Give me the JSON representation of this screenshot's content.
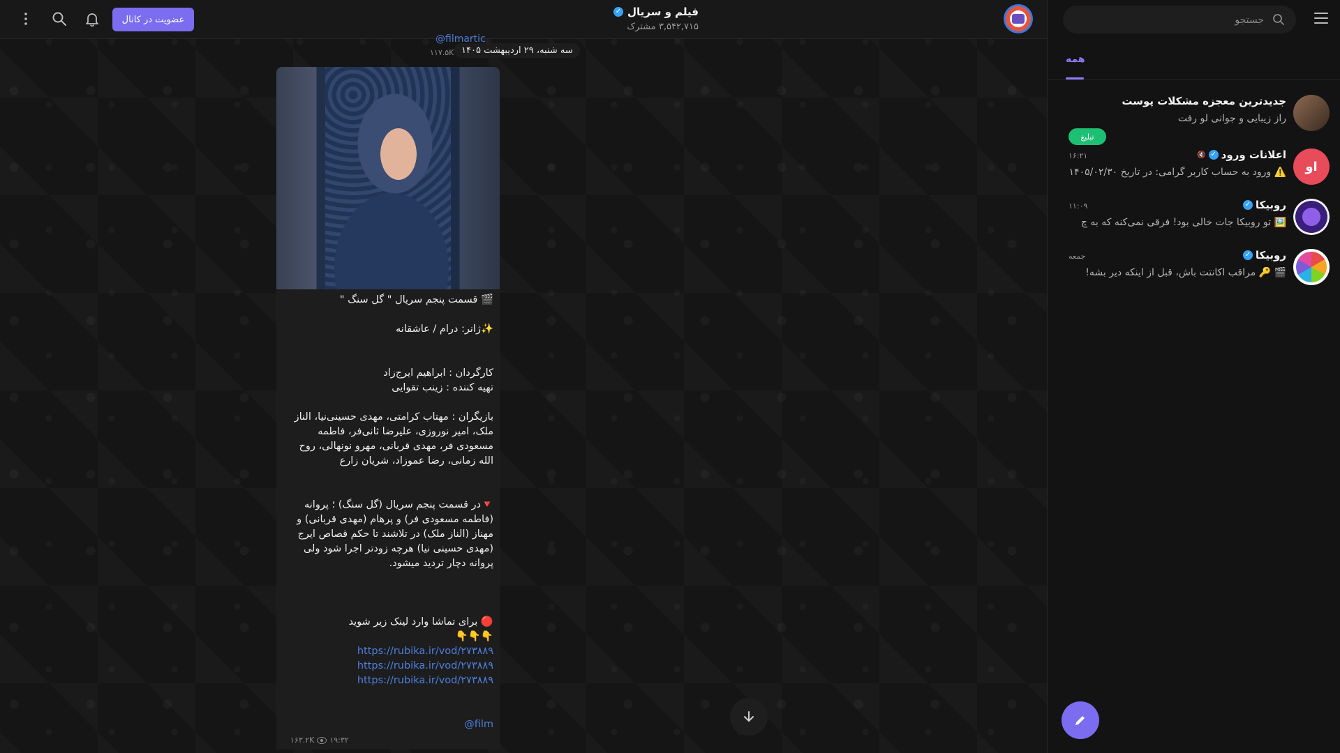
{
  "header": {
    "channel_name": "فیلم و سریال",
    "subscribers": "۳,۵۴۲,۷۱۵ مشترک",
    "join_button": "عضویت در کانال"
  },
  "date_separator": "سه شنبه، ۲۹ اردیبهشت ۱۴۰۵",
  "previous_message": {
    "handle": "@filmartic",
    "views": "۱۱۷.۵K"
  },
  "message": {
    "title": "🎬 قسمت پنجم سریال \" گل سنگ \"",
    "genre": "✨ژانر: درام / عاشقانه",
    "director": "کارگردان : ابراهیم ایرج‌زاد",
    "producer": "تهیه کننده : زینب تقوایی",
    "cast": "بازیگران : مهتاب کرامتی، مهدی حسینی‌نیا، الناز ملک، امیر نوروزی، علیرضا ثانی‌فر، فاطمه مسعودی فر، مهدی قربانی، مهرو نونهالی، روح الله زمانی، رضا عموزاد، شریان زارع",
    "synopsis": "🔻در قسمت پنجم سریال (گل سنگ) ؛ پروانه (فاطمه مسعودی فر) و پرهام (مهدی قربانی) و مهناز (الناز ملک) در تلاشند تا حکم قصاص ایرج (مهدی حسینی نیا) هرچه زودتر اجرا شود ولی پروانه دچار تردید میشود.",
    "watch_cta": "🔴 برای تماشا وارد لینک زیر شوید",
    "pointers": "👇👇👇",
    "links": [
      "https://rubika.ir/vod/۲۷۳۸۸۹",
      "https://rubika.ir/vod/۲۷۳۸۸۹",
      "https://rubika.ir/vod/۲۷۳۸۸۹"
    ],
    "handle": "@film",
    "views": "۱۶۳.۲K",
    "time": "۱۹:۳۲"
  },
  "sidebar": {
    "search_placeholder": "جستجو",
    "tab_all": "همه",
    "chats": [
      {
        "name": "جدیدترین معجزه مشکلات پوست",
        "preview": "راز زیبایی و جوانی لو رفت",
        "badge": "تبلیغ",
        "avatar_color": "#7a5a45"
      },
      {
        "name": "اعلانات ورود",
        "preview": "⚠️ ورود به حساب کاربر گرامی: در تاریخ ۱۴۰۵/۰۲/۳۰",
        "time": "۱۶:۲۱",
        "avatar_text": "او",
        "avatar_color": "#e84b5a"
      },
      {
        "name": "روبیکا",
        "preview": "🖼️ تو روبیکا جات خالی بود! فرقی نمی‌کنه که به چ",
        "time": "۱۱:۰۹",
        "avatar_color": "#6a3fbf"
      },
      {
        "name": "روبیکا",
        "preview": "🎬 🔑 مراقب اکانتت باش، قبل از اینکه دیر بشه!",
        "time": "جمعه",
        "avatar_color": "#ffffff"
      }
    ]
  },
  "colors": {
    "accent": "#7b6cf0",
    "link": "#4d80e0",
    "badge": "#1dbf73"
  }
}
